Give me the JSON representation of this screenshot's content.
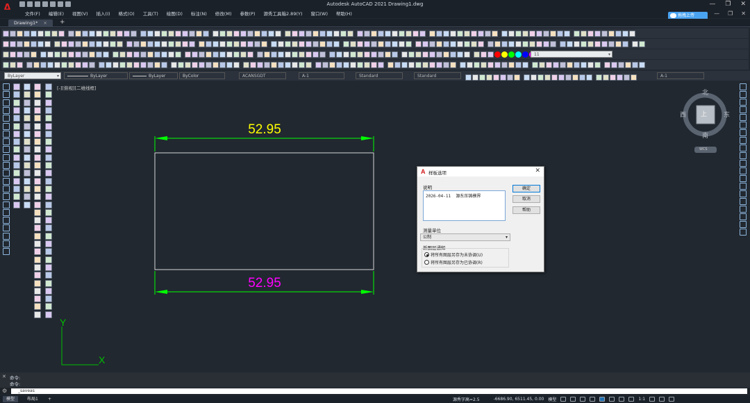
{
  "window": {
    "title": "Autodesk AutoCAD 2021    Drawing1.dwg",
    "controls": [
      "—",
      "❐",
      "✕"
    ]
  },
  "menu": {
    "items": [
      "文件(F)",
      "编辑(E)",
      "视图(V)",
      "插入(I)",
      "格式(O)",
      "工具(T)",
      "绘图(D)",
      "标注(N)",
      "修改(M)",
      "参数(P)",
      "源秀工具箱2.89(Y)",
      "窗口(W)",
      "帮助(H)"
    ],
    "right_controls": [
      "—",
      "❐",
      "✕"
    ],
    "cloud_button": "拖拽上传"
  },
  "tabs": {
    "active": "Drawing1*",
    "close": "×",
    "add": "+"
  },
  "properties": {
    "layer": "ByLayer",
    "linetype": "ByLayer",
    "lineweight": "ByLayer",
    "color": "ByColor",
    "text_style": "ACANSGDT",
    "annotation_scale": "A-1",
    "dim_style": "Standard",
    "table_style": "Standard",
    "multileader_style": "A-1",
    "layer_combo": "11"
  },
  "viewport": {
    "label": "[-][俯视][二维线框]"
  },
  "drawing": {
    "top_dim": "52.95",
    "bottom_dim": "52.95",
    "top_dim_color": "#ffff00",
    "bottom_dim_color": "#ff00ff",
    "dim_line_color": "#00ff00",
    "rect_color": "#d8d8d8",
    "ucs_y": "Y",
    "ucs_x": "X",
    "ucs_color": "#00c000"
  },
  "viewcube": {
    "north": "北",
    "south": "南",
    "east": "东",
    "west": "西",
    "face": "上",
    "wcs": "WCS"
  },
  "dialog": {
    "title": "样板选项",
    "description_label": "说明",
    "description": "2026-04-11  源东压铸模界",
    "ok": "确定",
    "cancel": "取消",
    "help": "帮助",
    "units_label": "测量单位",
    "units_value": "公制",
    "notification_label": "新图层通知",
    "radio1": "将所有图层另存为未协调(U)",
    "radio2": "将所有图层另存为已协调(R)",
    "radio1_selected": true
  },
  "command": {
    "history": [
      "命令:",
      "命令:"
    ],
    "input": "_saveas"
  },
  "status": {
    "model_tab": "模型",
    "layout_tab": "布局1",
    "text_style": "源秀字高=2.5",
    "coords": "-6686.90, 6511.45, 0.00",
    "mode": "模型",
    "scale": "1:1"
  }
}
